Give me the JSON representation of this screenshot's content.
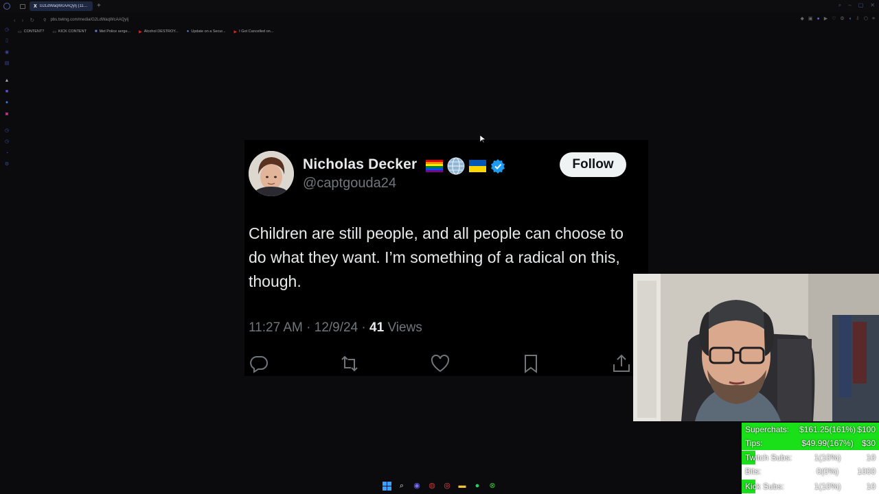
{
  "browser": {
    "tab_favicon": "X",
    "tab_title": "G2LdWaqWcAAQyIj (1179×",
    "new_tab_symbol": "+",
    "url": "pbs.twimg.com/media/G2LdWaqWcAAQyIj",
    "bookmarks": [
      {
        "label": "CONTENT?",
        "icon": "folder-icon"
      },
      {
        "label": "KICK CONTENT",
        "icon": "folder-icon"
      },
      {
        "label": "Met Police serge...",
        "icon": "tv-icon"
      },
      {
        "label": "Alcohol DESTROY...",
        "icon": "youtube-icon"
      },
      {
        "label": "Update on a Secur...",
        "icon": "discord-icon"
      },
      {
        "label": "I Got Cancelled on...",
        "icon": "youtube-icon"
      }
    ]
  },
  "tweet": {
    "author_name": "Nicholas Decker",
    "handle": "@captgouda24",
    "follow_label": "Follow",
    "text": "Children are still people, and all people can choose to do what they want. I’m something of a radical on this, though.",
    "time": "11:27 AM · 12/9/24 · ",
    "views_count": "41",
    "views_label": " Views",
    "badges": [
      "rainbow-flag-icon",
      "globe-icon",
      "ukraine-flag-icon",
      "verified-badge-icon"
    ],
    "actions": [
      "reply-icon",
      "retweet-icon",
      "like-icon",
      "bookmark-icon",
      "share-icon"
    ]
  },
  "stats": {
    "rows": [
      {
        "label": "Superchats:",
        "value": "$161.25(161%)",
        "goal": "$100",
        "fill": 1.0
      },
      {
        "label": "Tips:",
        "value": "$49.99(167%)",
        "goal": "$30",
        "fill": 1.0
      },
      {
        "label": "Twitch Subs:",
        "value": "1(10%)",
        "goal": "10",
        "fill": 0.1
      },
      {
        "label": "Bits:",
        "value": "0(0%)",
        "goal": "1000",
        "fill": 0.0
      },
      {
        "label": "Kick Subs:",
        "value": "1(10%)",
        "goal": "10",
        "fill": 0.1
      }
    ],
    "bar_color": "#19e019"
  },
  "taskbar": {
    "icons": [
      "windows-start-icon",
      "search-icon",
      "app-icon",
      "app-icon-2",
      "chrome-icon",
      "file-explorer-icon",
      "spotify-icon",
      "xbox-icon"
    ]
  }
}
